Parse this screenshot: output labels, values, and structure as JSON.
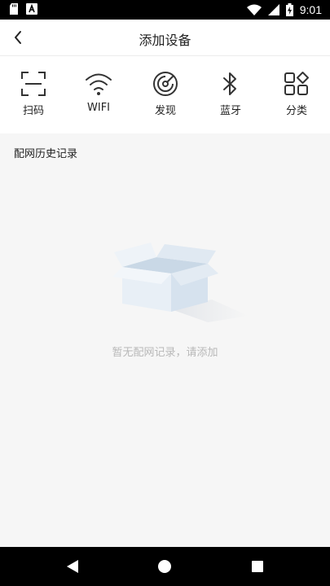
{
  "status_bar": {
    "time": "9:01",
    "icons": [
      "sd-card-icon",
      "a-notification-icon",
      "wifi-icon",
      "signal-icon",
      "battery-charging-icon"
    ]
  },
  "header": {
    "title": "添加设备",
    "back_icon": "chevron-left-icon"
  },
  "methods": [
    {
      "label": "扫码",
      "icon": "scan-icon"
    },
    {
      "label": "WIFI",
      "icon": "wifi-icon"
    },
    {
      "label": "发现",
      "icon": "radar-icon"
    },
    {
      "label": "蓝牙",
      "icon": "bluetooth-icon"
    },
    {
      "label": "分类",
      "icon": "category-icon"
    }
  ],
  "history": {
    "title": "配网历史记录",
    "empty_text": "暂无配网记录，请添加",
    "empty_icon": "empty-box-icon"
  },
  "nav_bar": {
    "buttons": [
      "back-triangle-icon",
      "home-circle-icon",
      "recents-square-icon"
    ]
  }
}
